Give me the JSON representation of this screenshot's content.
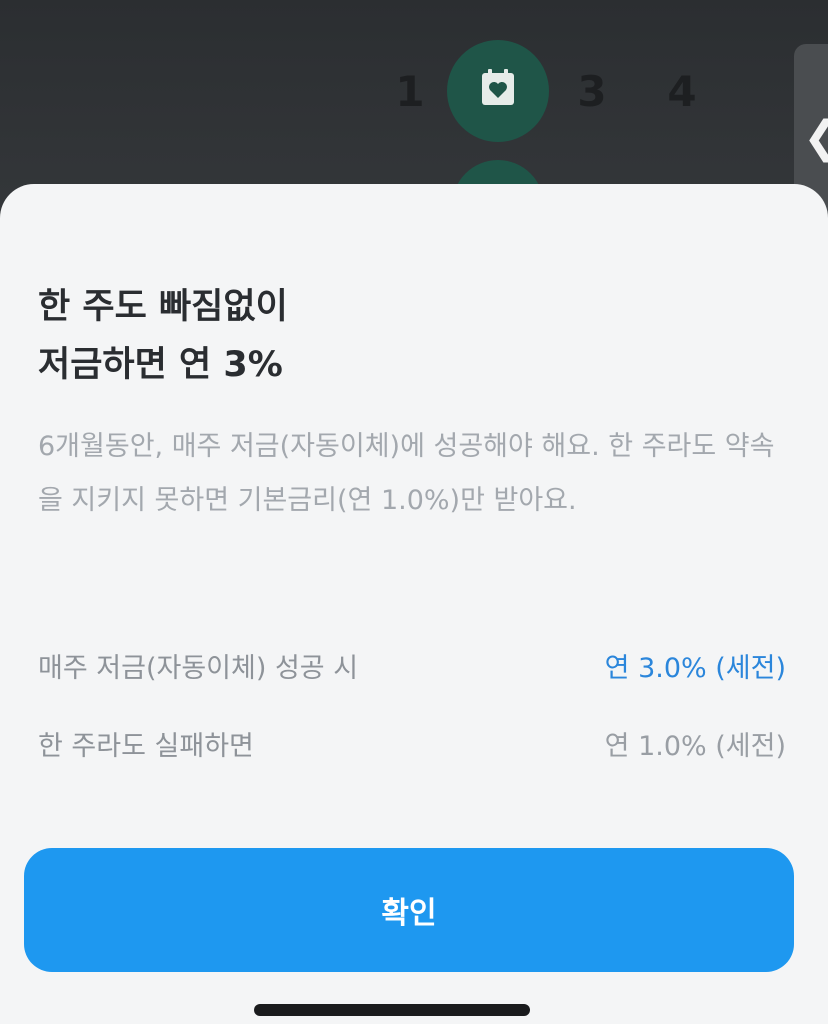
{
  "steps": {
    "step1": "1",
    "step3": "3",
    "step4": "4",
    "active_icon": "calendar-heart-icon"
  },
  "side_handle": {
    "arrow": "❮",
    "icon": "chevron-left-icon"
  },
  "sheet": {
    "title_line1": "한 주도 빠짐없이",
    "title_line2": "저금하면 연 3%",
    "description": "6개월동안, 매주 저금(자동이체)에 성공해야 해요. 한 주라도 약속을 지키지 못하면 기본금리(연 1.0%)만 받아요.",
    "rows": [
      {
        "label": "매주 저금(자동이체) 성공 시",
        "value": "연 3.0% (세전)"
      },
      {
        "label": "한 주라도 실패하면",
        "value": "연 1.0% (세전)"
      }
    ],
    "confirm_label": "확인"
  },
  "colors": {
    "accent_blue": "#1e98f0",
    "rate_blue": "#2b86db",
    "step_green": "#1f5548"
  }
}
